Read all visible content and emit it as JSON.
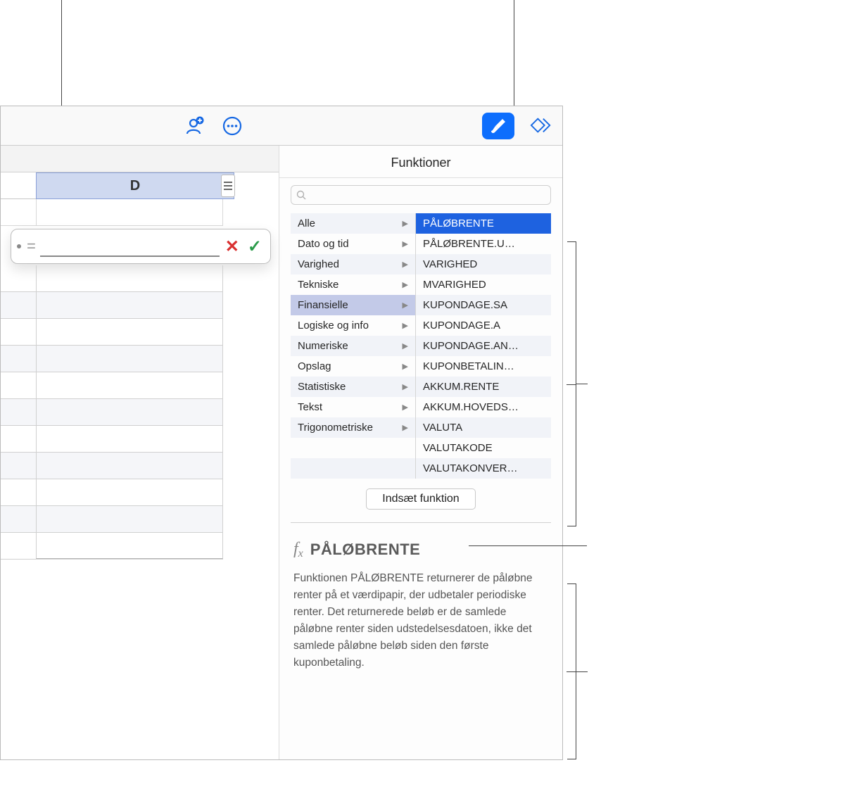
{
  "toolbar": {
    "collaborate_icon": "collaborate",
    "more_icon": "more",
    "format_icon": "format",
    "organize_icon": "organize"
  },
  "column": {
    "label": "D"
  },
  "formula": {
    "equals": "=",
    "value": "",
    "cancel": "✕",
    "accept": "✓"
  },
  "panel": {
    "title": "Funktioner",
    "search_placeholder": "",
    "insert_button": "Indsæt funktion"
  },
  "categories": [
    {
      "label": "Alle",
      "selected": false
    },
    {
      "label": "Dato og tid",
      "selected": false
    },
    {
      "label": "Varighed",
      "selected": false
    },
    {
      "label": "Tekniske",
      "selected": false
    },
    {
      "label": "Finansielle",
      "selected": true
    },
    {
      "label": "Logiske og info",
      "selected": false
    },
    {
      "label": "Numeriske",
      "selected": false
    },
    {
      "label": "Opslag",
      "selected": false
    },
    {
      "label": "Statistiske",
      "selected": false
    },
    {
      "label": "Tekst",
      "selected": false
    },
    {
      "label": "Trigonometriske",
      "selected": false
    }
  ],
  "functions": [
    {
      "label": "PÅLØBRENTE",
      "selected": true
    },
    {
      "label": "PÅLØBRENTE.U…",
      "selected": false
    },
    {
      "label": "VARIGHED",
      "selected": false
    },
    {
      "label": "MVARIGHED",
      "selected": false
    },
    {
      "label": "KUPONDAGE.SA",
      "selected": false
    },
    {
      "label": "KUPONDAGE.A",
      "selected": false
    },
    {
      "label": "KUPONDAGE.AN…",
      "selected": false
    },
    {
      "label": "KUPONBETALIN…",
      "selected": false
    },
    {
      "label": "AKKUM.RENTE",
      "selected": false
    },
    {
      "label": "AKKUM.HOVEDS…",
      "selected": false
    },
    {
      "label": "VALUTA",
      "selected": false
    },
    {
      "label": "VALUTAKODE",
      "selected": false
    },
    {
      "label": "VALUTAKONVER…",
      "selected": false
    }
  ],
  "description": {
    "fx": "fx",
    "title": "PÅLØBRENTE",
    "body": "Funktionen PÅLØBRENTE returnerer de påløbne renter på et værdipapir, der udbetaler periodiske renter. Det returnerede beløb er de samlede påløbne renter siden udstedelsesdatoen, ikke det samlede påløbne beløb siden den første kuponbetaling."
  }
}
